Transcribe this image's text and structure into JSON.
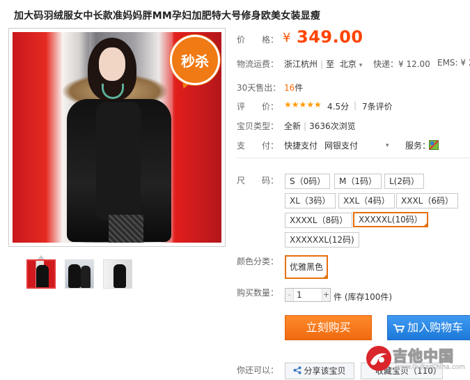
{
  "product": {
    "title": "加大码羽绒服女中长款准妈妈胖MM孕妇加肥特大号修身欧美女装显瘦",
    "badge": "秒杀"
  },
  "price": {
    "label": "价　　格：",
    "symbol": "¥",
    "value": "349.00"
  },
  "shipping": {
    "label": "物流运费：",
    "from": "浙江杭州",
    "to_prefix": "至",
    "to": "北京",
    "express": "快递：¥ 12.00",
    "ems": "EMS: ¥ 2"
  },
  "sales": {
    "label": "30天售出：",
    "count": "16",
    "unit": "件"
  },
  "rating": {
    "label": "评　　价：",
    "stars": "★★★★★",
    "score": "4.5分",
    "reviews": "7条评价"
  },
  "type": {
    "label": "宝贝类型：",
    "condition": "全新",
    "views": "3636次浏览"
  },
  "payment": {
    "label": "支　　付：",
    "methods": [
      "快捷支付",
      "网银支付"
    ],
    "service_label": "服务："
  },
  "size": {
    "label": "尺　　码：",
    "options": [
      "S（0码）",
      "M（1码）",
      "L(2码）",
      "XL（3码）",
      "XXL（4码）",
      "XXXL（6码）",
      "XXXXL（8码）",
      "XXXXXL(10码）",
      "XXXXXXL(12码)"
    ],
    "selected": "XXXXXL(10码）"
  },
  "color": {
    "label": "颜色分类：",
    "option": "优雅黑色"
  },
  "quantity": {
    "label": "购买数量：",
    "minus": "-",
    "value": "1",
    "plus": "+",
    "stock": "件  (库存100件)"
  },
  "actions": {
    "buy": "立刻购买",
    "add_cart": "加入购物车"
  },
  "extra": {
    "label": "你还可以：",
    "share": "分享该宝贝",
    "favorite": "收藏宝贝（110）"
  },
  "watermark": {
    "cn": "吉他中国",
    "en": "www.GuitarChina.com"
  },
  "colors": {
    "price": "#ff4400",
    "buy_button": "#f47b1a",
    "cart_button": "#2a86e2",
    "selected_border": "#e4700c",
    "star": "#ff9a00"
  }
}
